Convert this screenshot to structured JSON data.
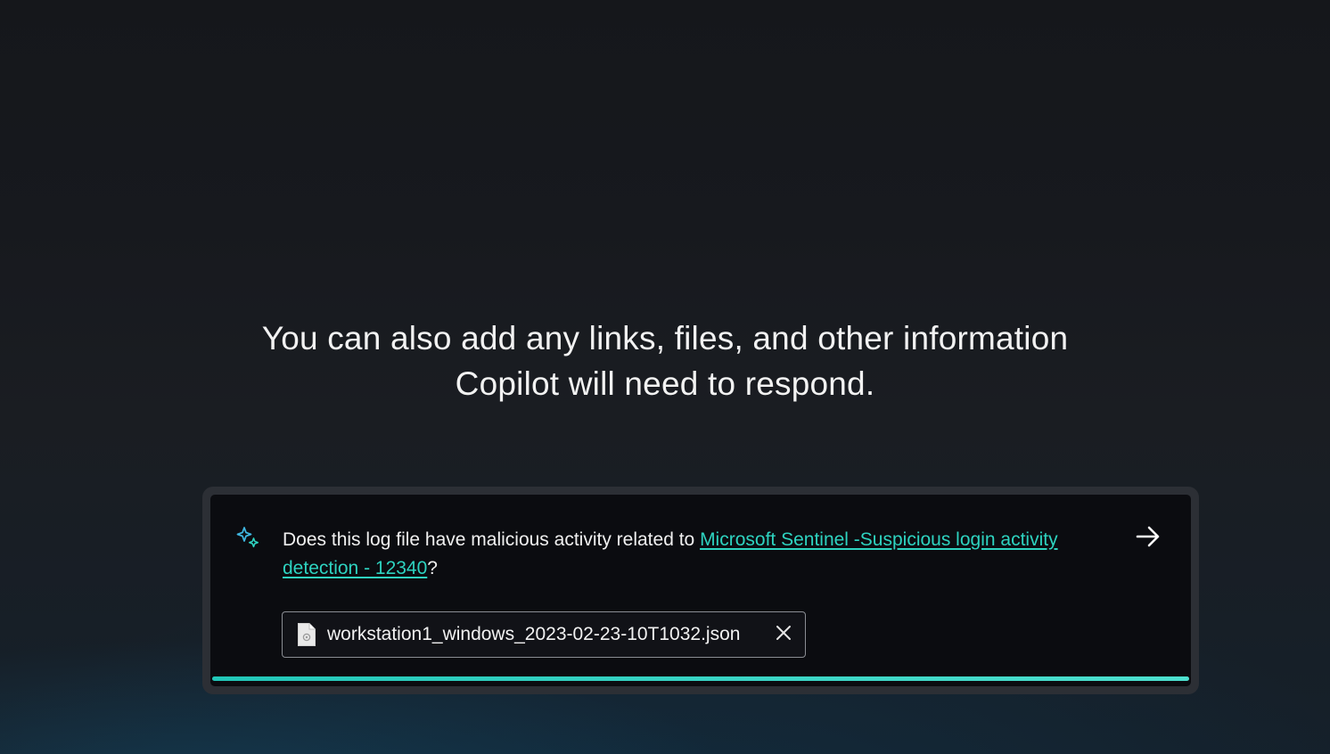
{
  "headline": {
    "line1": "You can also add any links, files, and other information",
    "line2": "Copilot will need to respond."
  },
  "prompt": {
    "text_before": "Does this log file have malicious activity related to ",
    "link_text": "Microsoft Sentinel -Suspicious login activity detection - 12340",
    "text_after": "?"
  },
  "attachment": {
    "file_name": "workstation1_windows_2023-02-23-10T1032.json",
    "icon": "file-icon",
    "remove_icon": "close-icon"
  },
  "send": {
    "icon": "arrow-right-icon"
  },
  "progress": {
    "value": 1.0
  },
  "colors": {
    "accent": "#2ed3c0",
    "card_background": "#0b0c10",
    "frame": "#2c2f35"
  }
}
